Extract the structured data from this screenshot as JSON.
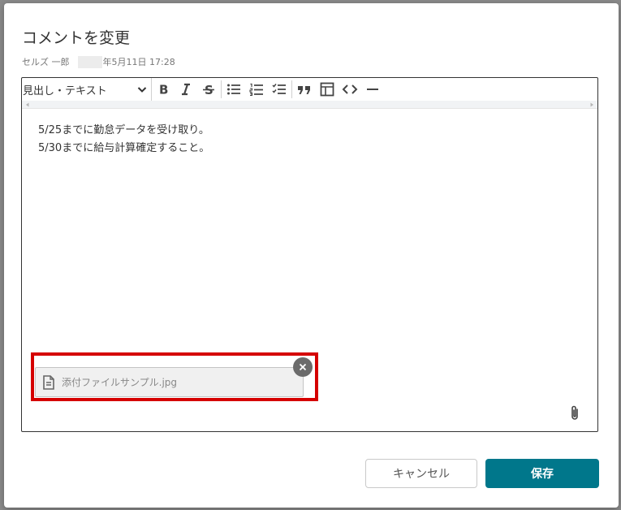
{
  "dialog": {
    "title": "コメントを変更",
    "meta": {
      "author": "セルズ 一郎",
      "date": "年5月11日 17:28"
    }
  },
  "toolbar": {
    "heading_select": "見出し・テキスト",
    "icons": [
      "bold-icon",
      "italic-icon",
      "strikethrough-icon",
      "bullet-list-icon",
      "numbered-list-icon",
      "task-list-icon",
      "quote-icon",
      "table-icon",
      "code-icon",
      "horizontal-rule-icon"
    ]
  },
  "editor": {
    "lines": [
      "5/25までに勤怠データを受け取り。",
      "5/30までに給与計算確定すること。"
    ]
  },
  "attachment": {
    "filename": "添付ファイルサンプル.jpg"
  },
  "buttons": {
    "cancel": "キャンセル",
    "save": "保存"
  },
  "colors": {
    "save_button": "#00778b",
    "highlight_border": "#d50000"
  }
}
